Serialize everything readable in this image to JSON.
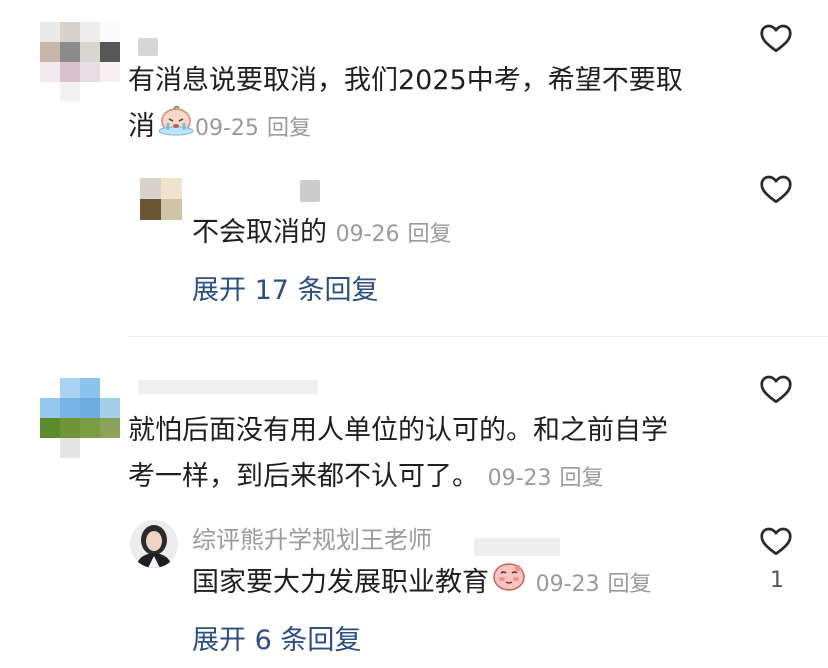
{
  "comments": [
    {
      "text_line1": "有消息说要取消，我们2025中考，希望不要取",
      "text_line2": "消",
      "date": "09-25",
      "reply_label": "回复",
      "replies": [
        {
          "text": "不会取消的",
          "date": "09-26",
          "reply_label": "回复"
        }
      ],
      "expand_label": "展开 17 条回复"
    },
    {
      "text_line1": "就怕后面没有用人单位的认可的。和之前自学",
      "text_line2": "考一样，到后来都不认可了。",
      "date": "09-23",
      "reply_label": "回复",
      "replies": [
        {
          "username": "综评熊升学规划王老师",
          "text": "国家要大力发展职业教育",
          "date": "09-23",
          "reply_label": "回复",
          "likes": "1"
        }
      ],
      "expand_label": "展开 6 条回复"
    }
  ],
  "icons": {
    "like": "heart-outline-icon",
    "emoji_1": "crying-face-emoji",
    "emoji_2": "blushing-face-emoji"
  },
  "colors": {
    "text": "#1f1f1f",
    "meta": "#9a9a9a",
    "link": "#2b4f80"
  }
}
